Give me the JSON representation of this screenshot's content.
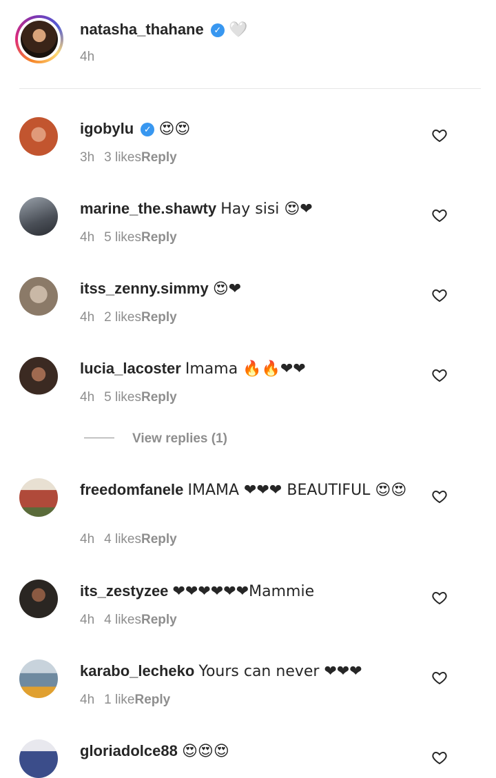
{
  "caption": {
    "username": "natasha_thahane",
    "emoji": "🤍",
    "time": "4h"
  },
  "comments": [
    {
      "username": "igobylu",
      "verified": true,
      "text": "😍😍",
      "time": "3h",
      "likes": "3 likes",
      "reply": "Reply",
      "avatar_color": "#c2552f"
    },
    {
      "username": "marine_the.shawty",
      "verified": false,
      "text": "Hay sisi 😍❤",
      "time": "4h",
      "likes": "5 likes",
      "reply": "Reply",
      "avatar_color": "#4a4f57"
    },
    {
      "username": "itss_zenny.simmy",
      "verified": false,
      "text": "😍❤",
      "time": "4h",
      "likes": "2 likes",
      "reply": "Reply",
      "avatar_color": "#8b7a68"
    },
    {
      "username": "lucia_lacoster",
      "verified": false,
      "text": "Imama 🔥🔥❤❤",
      "time": "4h",
      "likes": "5 likes",
      "reply": "Reply",
      "avatar_color": "#3b2a22"
    },
    {
      "username": "freedomfanele",
      "verified": false,
      "text": "IMAMA ❤❤❤ BEAUTIFUL 😍😍",
      "time": "4h",
      "likes": "4 likes",
      "reply": "Reply",
      "avatar_color": "#b04a3a"
    },
    {
      "username": "its_zestyzee",
      "verified": false,
      "text": "❤❤❤❤❤❤Mammie",
      "time": "4h",
      "likes": "4 likes",
      "reply": "Reply",
      "avatar_color": "#2a2622"
    },
    {
      "username": "karabo_lecheko",
      "verified": false,
      "text": "Yours can never ❤❤❤",
      "time": "4h",
      "likes": "1 like",
      "reply": "Reply",
      "avatar_color": "#6f8aa0"
    },
    {
      "username": "gloriadolce88",
      "verified": false,
      "text": "😍😍😍",
      "time": "",
      "likes": "",
      "reply": "",
      "avatar_color": "#3b4d8a"
    }
  ],
  "view_replies": "View replies (1)",
  "colors": {
    "verified": "#3897f0",
    "meta": "#8e8e8e",
    "text": "#262626"
  }
}
